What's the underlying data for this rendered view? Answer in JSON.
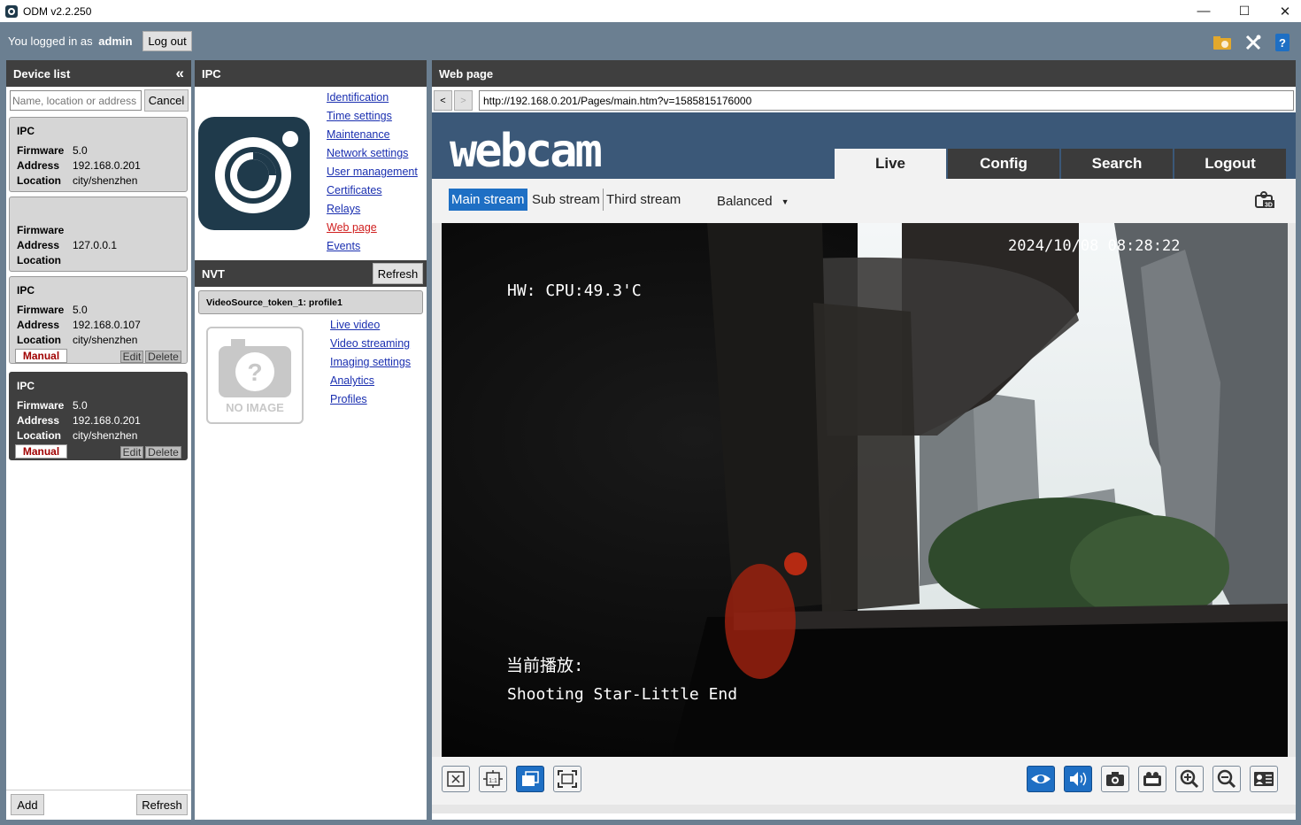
{
  "window": {
    "title": "ODM v2.2.250",
    "minimize": "—",
    "maximize": "☐",
    "close": "✕"
  },
  "topbar": {
    "logged_prefix": "You logged in as",
    "user": "admin",
    "logout_label": "Log out",
    "icons": [
      "folder-settings-icon",
      "tools-icon",
      "help-book-icon"
    ]
  },
  "device_list": {
    "title": "Device list",
    "collapse": "«",
    "search_placeholder": "Name, location or address",
    "cancel_label": "Cancel",
    "add_label": "Add",
    "refresh_label": "Refresh",
    "labels": {
      "firmware": "Firmware",
      "address": "Address",
      "location": "Location",
      "manual": "Manual",
      "edit": "Edit",
      "delete": "Delete"
    },
    "devices": [
      {
        "type": "IPC",
        "firmware": "5.0",
        "address": "192.168.0.201",
        "location": "city/shenzhen"
      },
      {
        "type": "",
        "firmware": "",
        "address": "127.0.0.1",
        "location": ""
      },
      {
        "type": "IPC",
        "firmware": "5.0",
        "address": "192.168.0.107",
        "location": "city/shenzhen"
      },
      {
        "type": "IPC",
        "firmware": "5.0",
        "address": "192.168.0.201",
        "location": "city/shenzhen"
      }
    ]
  },
  "ipc": {
    "title": "IPC",
    "links": [
      "Identification",
      "Time settings",
      "Maintenance",
      "Network settings",
      "User management",
      "Certificates",
      "Relays",
      "Web page",
      "Events"
    ],
    "active_link": "Web page"
  },
  "nvt": {
    "title": "NVT",
    "refresh_label": "Refresh",
    "profile": "VideoSource_token_1: profile1",
    "no_image": "NO IMAGE",
    "links": [
      "Live video",
      "Video streaming",
      "Imaging settings",
      "Analytics",
      "Profiles"
    ]
  },
  "webpage": {
    "title": "Web page",
    "back": "<",
    "forward": ">",
    "url": "http://192.168.0.201/Pages/main.htm?v=1585815176000",
    "logo": "webcam",
    "tabs": [
      "Live",
      "Config",
      "Search",
      "Logout"
    ],
    "active_tab": "Live",
    "streams": [
      "Main stream",
      "Sub stream",
      "Third stream"
    ],
    "active_stream": "Main stream",
    "quality": "Balanced",
    "osd": {
      "timestamp": "2024/10/08 08:28:22",
      "cpu": "HW: CPU:49.3'C",
      "playing_label": "当前播放:",
      "song": "Shooting Star-Little End"
    },
    "controls_left": [
      "close-video-icon",
      "fit-1to1-icon",
      "window-mode-icon",
      "fullscreen-icon"
    ],
    "controls_right": [
      "eye-icon",
      "audio-icon",
      "snapshot-icon",
      "record-icon",
      "zoom-in-icon",
      "zoom-out-icon",
      "ptz-panel-icon"
    ]
  },
  "colors": {
    "topbar": "#6b7f91",
    "header_dark": "#3f3f3f",
    "link": "#1a2fb0",
    "active_link": "#d02020",
    "webcam_blue": "#3b5878",
    "stream_active": "#1e6fc4"
  }
}
